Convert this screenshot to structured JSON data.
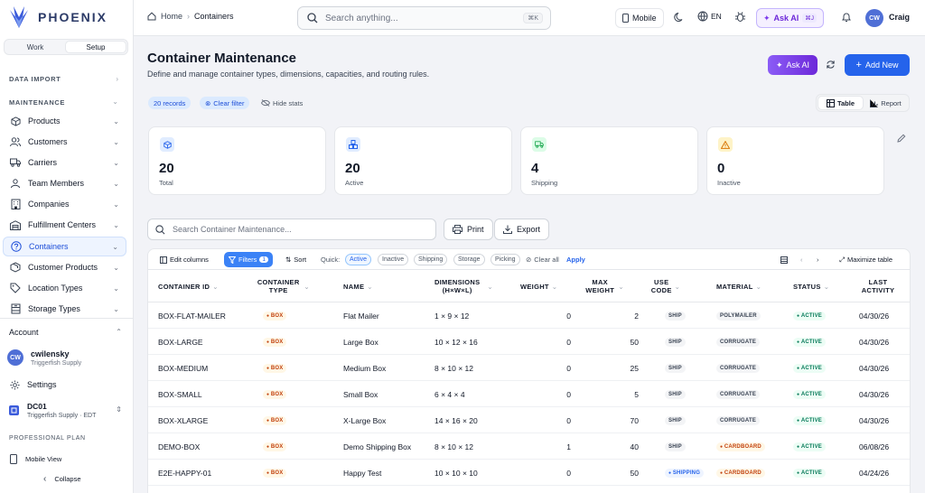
{
  "brand": {
    "name": "PHOENIX"
  },
  "sidebar": {
    "toggle": {
      "work": "Work",
      "setup": "Setup"
    },
    "data_import": "DATA IMPORT",
    "maintenance": "MAINTENANCE",
    "items": [
      {
        "label": "Products"
      },
      {
        "label": "Customers"
      },
      {
        "label": "Carriers"
      },
      {
        "label": "Team Members"
      },
      {
        "label": "Companies"
      },
      {
        "label": "Fulfillment Centers"
      },
      {
        "label": "Containers"
      },
      {
        "label": "Customer Products"
      },
      {
        "label": "Location Types"
      },
      {
        "label": "Storage Types"
      }
    ],
    "account_label": "Account",
    "user": {
      "initials": "CW",
      "name": "cwilensky",
      "org": "Triggerfish Supply"
    },
    "settings": "Settings",
    "dc": {
      "code": "DC01",
      "detail": "Triggerfish Supply · EDT"
    },
    "plan": "PROFESSIONAL PLAN",
    "mobile_view": "Mobile View",
    "collapse": "Collapse"
  },
  "topbar": {
    "home": "Home",
    "current": "Containers",
    "search_placeholder": "Search anything...",
    "search_kbd": "⌘K",
    "mobile": "Mobile",
    "lang": "EN",
    "ask_ai": "Ask AI",
    "ask_ai_kbd": "⌘J",
    "user_initials": "CW",
    "user_name": "Craig"
  },
  "page": {
    "title": "Container Maintenance",
    "subtitle": "Define and manage container types, dimensions, capacities, and routing rules.",
    "ask_ai": "Ask AI",
    "add_new": "Add New",
    "records": "20 records",
    "clear_filter": "Clear filter",
    "hide_stats": "Hide stats",
    "view_table": "Table",
    "view_report": "Report"
  },
  "stats": [
    {
      "value": "20",
      "label": "Total",
      "color": "#2563eb"
    },
    {
      "value": "20",
      "label": "Active",
      "color": "#2563eb"
    },
    {
      "value": "4",
      "label": "Shipping",
      "color": "#16a34a"
    },
    {
      "value": "0",
      "label": "Inactive",
      "color": "#d97706"
    }
  ],
  "table_controls": {
    "search_placeholder": "Search Container Maintenance...",
    "print": "Print",
    "export": "Export",
    "edit_columns": "Edit columns",
    "filters": "Filters",
    "filters_count": "1",
    "sort": "Sort",
    "quick_label": "Quick:",
    "quick": [
      "Active",
      "Inactive",
      "Shipping",
      "Storage",
      "Picking"
    ],
    "clear_all": "Clear all",
    "apply": "Apply",
    "maximize": "Maximize table"
  },
  "table": {
    "headers": [
      "CONTAINER ID",
      "CONTAINER TYPE",
      "NAME",
      "DIMENSIONS (H×W×L)",
      "WEIGHT",
      "MAX WEIGHT",
      "USE CODE",
      "MATERIAL",
      "STATUS",
      "LAST ACTIVITY"
    ],
    "rows": [
      {
        "id": "BOX-FLAT-MAILER",
        "type": "BOX",
        "name": "Flat Mailer",
        "dims": "1 × 9 × 12",
        "weight": "0",
        "max": "2",
        "use": "SHIP",
        "material": "POLYMAILER",
        "status": "ACTIVE",
        "date": "04/30/26"
      },
      {
        "id": "BOX-LARGE",
        "type": "BOX",
        "name": "Large Box",
        "dims": "10 × 12 × 16",
        "weight": "0",
        "max": "50",
        "use": "SHIP",
        "material": "CORRUGATE",
        "status": "ACTIVE",
        "date": "04/30/26"
      },
      {
        "id": "BOX-MEDIUM",
        "type": "BOX",
        "name": "Medium Box",
        "dims": "8 × 10 × 12",
        "weight": "0",
        "max": "25",
        "use": "SHIP",
        "material": "CORRUGATE",
        "status": "ACTIVE",
        "date": "04/30/26"
      },
      {
        "id": "BOX-SMALL",
        "type": "BOX",
        "name": "Small Box",
        "dims": "6 × 4 × 4",
        "weight": "0",
        "max": "5",
        "use": "SHIP",
        "material": "CORRUGATE",
        "status": "ACTIVE",
        "date": "04/30/26"
      },
      {
        "id": "BOX-XLARGE",
        "type": "BOX",
        "name": "X-Large Box",
        "dims": "14 × 16 × 20",
        "weight": "0",
        "max": "70",
        "use": "SHIP",
        "material": "CORRUGATE",
        "status": "ACTIVE",
        "date": "04/30/26"
      },
      {
        "id": "DEMO-BOX",
        "type": "BOX",
        "name": "Demo Shipping Box",
        "dims": "8 × 10 × 12",
        "weight": "1",
        "max": "40",
        "use": "SHIP",
        "material": "CARDBOARD",
        "status": "ACTIVE",
        "date": "06/08/26"
      },
      {
        "id": "E2E-HAPPY-01",
        "type": "BOX",
        "name": "Happy Test",
        "dims": "10 × 10 × 10",
        "weight": "0",
        "max": "50",
        "use": "SHIPPING",
        "material": "CARDBOARD",
        "status": "ACTIVE",
        "date": "04/24/26"
      }
    ]
  }
}
